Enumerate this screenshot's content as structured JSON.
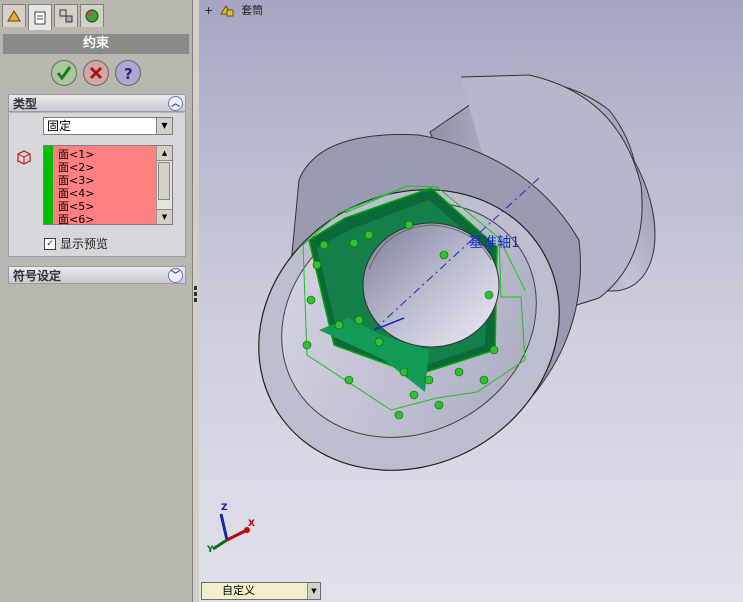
{
  "tabs": [
    "feature-manager-icon",
    "property-manager-icon",
    "configuration-manager-icon",
    "appearance-icon"
  ],
  "panel": {
    "title": "约束",
    "groups": {
      "type_title": "类型",
      "symbol_title": "符号设定"
    },
    "type_select": "固定",
    "faces": [
      "面<1>",
      "面<2>",
      "面<3>",
      "面<4>",
      "面<5>",
      "面<6>"
    ],
    "show_preview": "显示预览"
  },
  "viewport": {
    "tree_root": "套筒",
    "axis_label": "基准轴1",
    "triad": {
      "x": "X",
      "y": "Y",
      "z": "Z"
    }
  },
  "config_select": "自定义",
  "colors": {
    "selection_green": "#00c000",
    "list_bg": "#ff8080",
    "panel_header": "#8a8a86"
  }
}
